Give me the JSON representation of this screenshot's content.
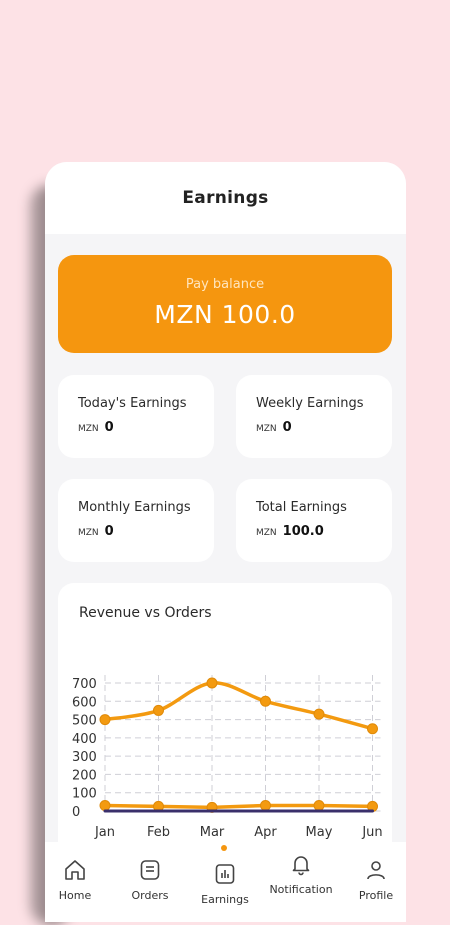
{
  "app_bar": {
    "title": "Earnings"
  },
  "balance": {
    "label": "Pay balance",
    "amount": "MZN 100.0"
  },
  "cards": {
    "today": {
      "title": "Today's Earnings",
      "currency": "MZN",
      "value": "0"
    },
    "weekly": {
      "title": "Weekly Earnings",
      "currency": "MZN",
      "value": "0"
    },
    "monthly": {
      "title": "Monthly Earnings",
      "currency": "MZN",
      "value": "0"
    },
    "total": {
      "title": "Total Earnings",
      "currency": "MZN",
      "value": "100.0"
    }
  },
  "chart_title": "Revenue vs Orders",
  "chart_data": {
    "type": "line",
    "title": "Revenue vs Orders",
    "categories": [
      "Jan",
      "Feb",
      "Mar",
      "Apr",
      "May",
      "Jun"
    ],
    "y_ticks": [
      0,
      100,
      200,
      300,
      400,
      500,
      600,
      700
    ],
    "ylim": [
      0,
      700
    ],
    "grid": true,
    "series": [
      {
        "values": [
          500,
          550,
          700,
          600,
          530,
          450
        ],
        "color": "#f39a10"
      },
      {
        "values": [
          30,
          25,
          20,
          30,
          30,
          25
        ],
        "color": "#f39a10"
      },
      {
        "values": [
          0,
          0,
          0,
          0,
          0,
          0
        ],
        "color": "#3a2f6b"
      }
    ]
  },
  "nav": {
    "items": [
      {
        "label": "Home",
        "icon": "home-icon"
      },
      {
        "label": "Orders",
        "icon": "orders-icon"
      },
      {
        "label": "Earnings",
        "icon": "earnings-icon",
        "active": true
      },
      {
        "label": "Notification",
        "icon": "bell-icon"
      },
      {
        "label": "Profile",
        "icon": "profile-icon"
      }
    ]
  },
  "colors": {
    "accent": "#f5960f",
    "background": "#fde2e6"
  }
}
